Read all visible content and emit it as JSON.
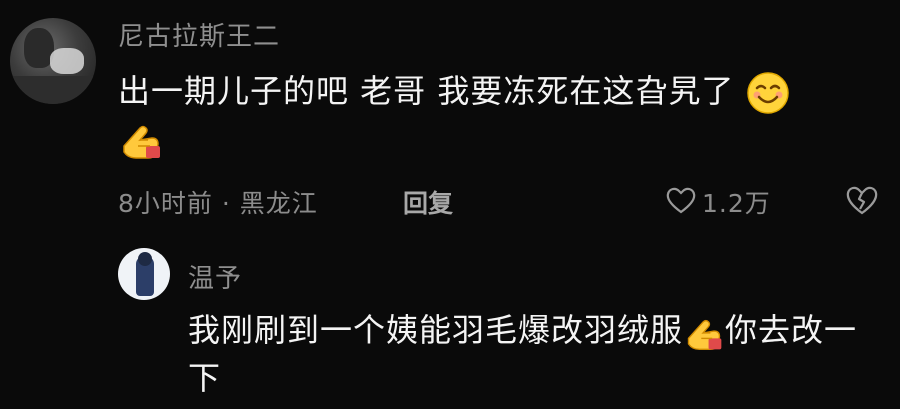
{
  "comment": {
    "username": "尼古拉斯王二",
    "text": "出一期儿子的吧 老哥 我要冻死在这旮旯了",
    "emoji_after_text": "smile-emoji",
    "emoji_line": "pointing-hand-emoji",
    "time_location": "8小时前 · 黑龙江",
    "reply_label": "回复",
    "like_count": "1.2万"
  },
  "reply": {
    "username": "温予",
    "text_part1": "我刚刷到一个姨能羽毛爆改羽绒服",
    "emoji_inline": "pointing-hand-emoji",
    "text_part2": "你去改一下"
  }
}
